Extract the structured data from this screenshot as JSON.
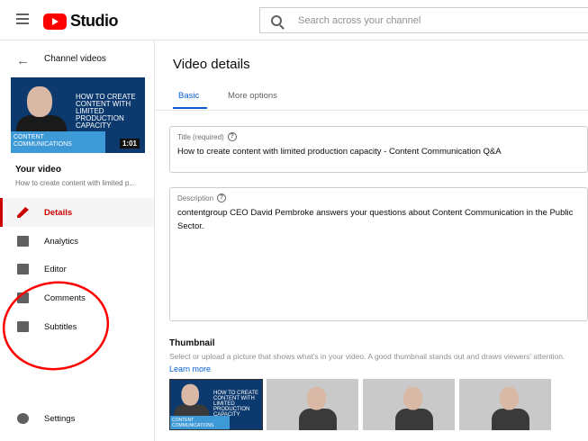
{
  "header": {
    "brand": "Studio",
    "search_placeholder": "Search across your channel"
  },
  "sidebar": {
    "back_label": "Channel videos",
    "video": {
      "title_lines": "HOW TO CREATE CONTENT WITH LIMITED PRODUCTION CAPACITY",
      "band": "CONTENT COMMUNICATIONS",
      "duration": "1:01"
    },
    "your_video": "Your video",
    "your_video_sub": "How to create content with limited p...",
    "items": [
      {
        "label": "Details"
      },
      {
        "label": "Analytics"
      },
      {
        "label": "Editor"
      },
      {
        "label": "Comments"
      },
      {
        "label": "Subtitles"
      }
    ],
    "settings": "Settings"
  },
  "main": {
    "title": "Video details",
    "tabs": [
      {
        "label": "Basic"
      },
      {
        "label": "More options"
      }
    ],
    "title_field": {
      "label": "Title (required)",
      "value": "How to create content with limited production capacity - Content Communication Q&A"
    },
    "description_field": {
      "label": "Description",
      "value": "contentgroup CEO David Pembroke answers your questions about Content Communication in the Public Sector."
    },
    "thumbnail": {
      "heading": "Thumbnail",
      "description": "Select or upload a picture that shows what's in your video. A good thumbnail stands out and draws viewers' attention.",
      "learn_more": "Learn more"
    }
  },
  "colors": {
    "accent": "#065fd4",
    "active": "#cc0000",
    "annotation": "#ff0000"
  }
}
